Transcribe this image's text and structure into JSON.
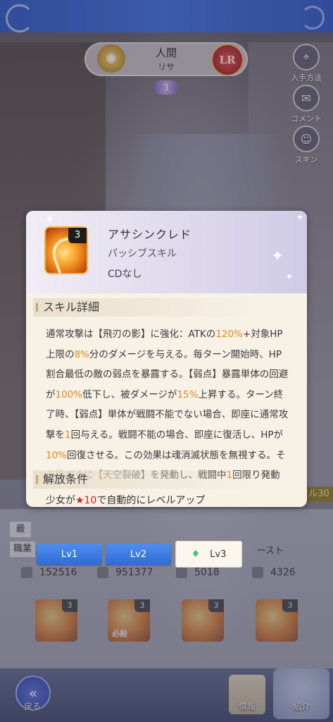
{
  "header": {
    "race": "人間",
    "name": "リサ",
    "rarity_badge": "LR",
    "stars": "3"
  },
  "side_buttons": [
    {
      "label": "入手方法",
      "icon": "location-pin-icon"
    },
    {
      "label": "コメント",
      "icon": "chat-bubble-icon"
    },
    {
      "label": "スキン",
      "icon": "skin-face-icon"
    }
  ],
  "popup": {
    "skill_level": "3",
    "skill_name": "アサシンクレド",
    "skill_type": "パッシブスキル",
    "cooldown": "CDなし",
    "detail_title": "スキル詳細",
    "description_segments": [
      {
        "text": "通常攻撃は【飛刃の影】に強化：ATKの",
        "color": "normal"
      },
      {
        "text": "120%",
        "color": "highlight"
      },
      {
        "text": "+対象HP上限の",
        "color": "normal"
      },
      {
        "text": "8%",
        "color": "highlight"
      },
      {
        "text": "分のダメージを与える。毎ターン開始時、HP割合最低の敵の弱点を暴露する。【弱点】暴露単体の回避が",
        "color": "normal"
      },
      {
        "text": "100%",
        "color": "highlight"
      },
      {
        "text": "低下し、被ダメージが",
        "color": "normal"
      },
      {
        "text": "15%",
        "color": "highlight"
      },
      {
        "text": "上昇する。ターン終了時、【弱点】単体が戦闘不能でない場合、即座に通常攻撃を",
        "color": "normal"
      },
      {
        "text": "1",
        "color": "highlight"
      },
      {
        "text": "回与える。戦闘不能の場合、即座に復活し、HPが",
        "color": "normal"
      },
      {
        "text": "10%",
        "color": "highlight"
      },
      {
        "text": "回復させる。この効果は魂消滅状態を無視する。その後すぐに【天空裂破】を発動し、戦闘中",
        "color": "normal"
      },
      {
        "text": "1",
        "color": "highlight"
      },
      {
        "text": "回限り発動",
        "color": "normal"
      }
    ],
    "unlock_title": "解放条件",
    "unlock_prefix": "少女が",
    "unlock_star": "★10",
    "unlock_suffix": "で自動的にレベルアップ"
  },
  "level_tabs": [
    {
      "label": "Lv1",
      "active": false
    },
    {
      "label": "Lv2",
      "active": false
    },
    {
      "label": "Lv3",
      "active": true
    }
  ],
  "stats_bg": {
    "row1_label": "最",
    "row2_label": "職業",
    "right_label": "ースト",
    "side_label": "ル30",
    "values": [
      "152516",
      "951377",
      "5018",
      "4326"
    ]
  },
  "skill_slots": [
    {
      "level": "3",
      "caption": ""
    },
    {
      "level": "3",
      "caption": "必殺"
    },
    {
      "level": "3",
      "caption": ""
    },
    {
      "level": "3",
      "caption": ""
    }
  ],
  "bottom_nav": {
    "back": "戻る",
    "info": "情報",
    "intro": "紹介"
  },
  "colors": {
    "highlight": "#e68a1e",
    "star_red": "#d42020",
    "tab_blue": "#2f6cd6",
    "topbar_blue": "#3c6fe0"
  }
}
